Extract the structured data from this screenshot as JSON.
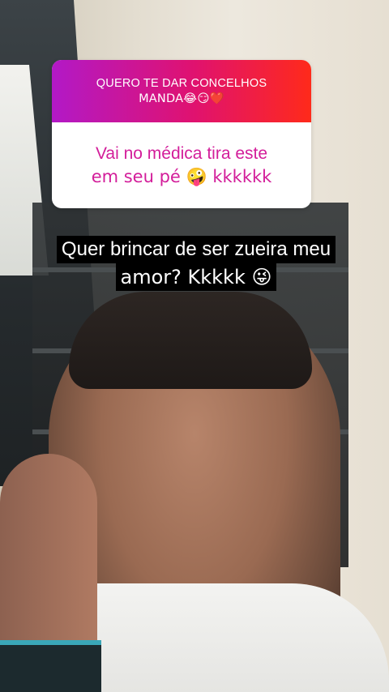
{
  "story": {
    "question_sticker": {
      "prompt_line1": "QUERO TE DAR CONCELHOS",
      "prompt_line2": "MANDA😂😏❤️",
      "answer_line1": "Vai no médica tira este",
      "answer_line2": "em seu pé 🤪 kkkkkk",
      "header_gradient": [
        "#b219c7",
        "#e0126f",
        "#ff2a1a"
      ],
      "answer_color": "#d31d9a"
    },
    "caption": {
      "line1": "Quer brincar de ser zueira meu",
      "line2": "amor? Kkkkk 😜",
      "text_color": "#ffffff",
      "background": "#000000"
    }
  }
}
